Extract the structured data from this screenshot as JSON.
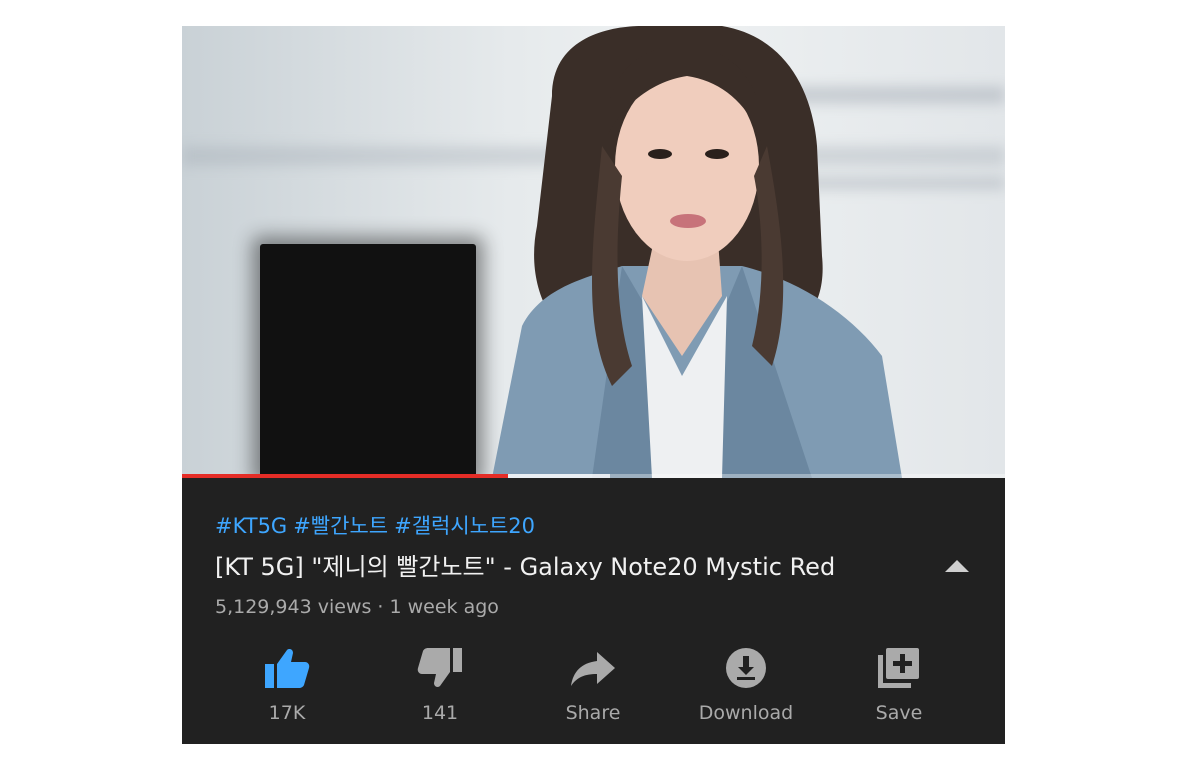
{
  "video": {
    "progress_played_fraction": 0.396,
    "progress_buffered_fraction": 0.52
  },
  "hashtags": [
    "#KT5G",
    "#빨간노트",
    "#갤럭시노트20"
  ],
  "title": "[KT 5G] \"제니의 빨간노트\" - Galaxy Note20 Mystic Red",
  "meta": "5,129,943 views · 1 week ago",
  "actions": {
    "like": {
      "label": "17K",
      "icon": "thumbs-up-icon",
      "active": true
    },
    "dislike": {
      "label": "141",
      "icon": "thumbs-down-icon"
    },
    "share": {
      "label": "Share",
      "icon": "share-arrow-icon"
    },
    "download": {
      "label": "Download",
      "icon": "download-icon"
    },
    "save": {
      "label": "Save",
      "icon": "playlist-add-icon"
    }
  },
  "colors": {
    "accent": "#3ea6ff",
    "progress": "#e52d27",
    "background": "#212121",
    "text_primary": "#f1f1f1",
    "text_secondary": "#aaaaaa"
  }
}
